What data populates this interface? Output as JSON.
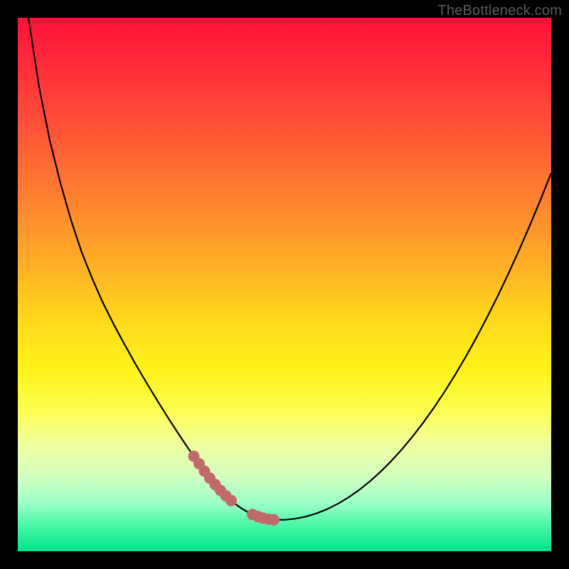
{
  "watermark": "TheBottleneck.com",
  "colors": {
    "highlight": "#c16a6a",
    "curve": "#000000"
  },
  "chart_data": {
    "type": "line",
    "title": "",
    "xlabel": "",
    "ylabel": "",
    "xlim": [
      0,
      100
    ],
    "ylim": [
      0,
      100
    ],
    "grid": false,
    "x": [
      0,
      2,
      4,
      6,
      8,
      10,
      12,
      14,
      16,
      18,
      20,
      22,
      24,
      26,
      28,
      30,
      32,
      33,
      34,
      35,
      36,
      37,
      38,
      39,
      40,
      41,
      42,
      43,
      44,
      45,
      46,
      47,
      48,
      50,
      52,
      54,
      56,
      58,
      60,
      62,
      64,
      66,
      68,
      70,
      72,
      74,
      76,
      78,
      80,
      82,
      84,
      86,
      88,
      90,
      92,
      94,
      96,
      98,
      100
    ],
    "values": [
      120,
      100,
      87,
      77,
      69,
      62,
      56,
      51,
      46.5,
      42.5,
      38.8,
      35.2,
      31.8,
      28.5,
      25.3,
      22.2,
      19.2,
      17.8,
      16.4,
      15.0,
      13.7,
      12.5,
      11.4,
      10.4,
      9.5,
      8.7,
      8.0,
      7.4,
      6.9,
      6.5,
      6.2,
      6.0,
      5.9,
      5.9,
      6.1,
      6.5,
      7.1,
      7.9,
      8.9,
      10.1,
      11.5,
      13.1,
      14.9,
      16.9,
      19.1,
      21.5,
      24.1,
      26.9,
      29.9,
      33.1,
      36.5,
      40.1,
      43.9,
      47.9,
      52.1,
      56.5,
      61.1,
      65.9,
      70.9
    ],
    "highlight_indices": [
      17,
      18,
      19,
      20,
      21,
      22,
      23,
      24,
      28,
      29,
      30,
      31,
      32
    ],
    "notes": "Screenshot shows only a black-bordered gradient plot with a single V-shaped curve; no axes, ticks, legend, or labels are visible. x/y arrays are estimated from visual position relative to the plot box (0..100 normalized). Values above 100 on y indicate the curve begins above the visible top edge."
  }
}
